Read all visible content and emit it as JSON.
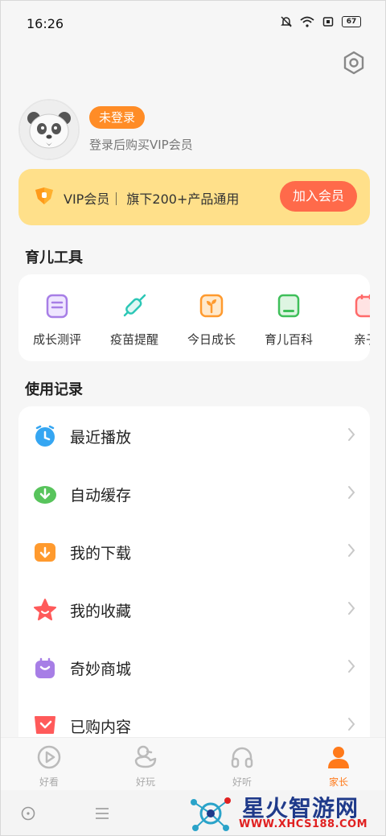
{
  "status_bar": {
    "time": "16:26",
    "battery": "67"
  },
  "profile": {
    "login_badge": "未登录",
    "subtitle": "登录后购买VIP会员"
  },
  "vip_banner": {
    "text": "VIP会员｜ 旗下200+产品通用",
    "button": "加入会员"
  },
  "tools": {
    "title": "育儿工具",
    "items": [
      {
        "label": "成长测评",
        "icon": "clipboard-icon",
        "color": "#a77ee6"
      },
      {
        "label": "疫苗提醒",
        "icon": "syringe-icon",
        "color": "#2cc7b6"
      },
      {
        "label": "今日成长",
        "icon": "sprout-icon",
        "color": "#ff9a2e"
      },
      {
        "label": "育儿百科",
        "icon": "book-icon",
        "color": "#3fbf5a"
      },
      {
        "label": "亲子",
        "icon": "calendar-icon",
        "color": "#ff6a6a"
      }
    ]
  },
  "records": {
    "title": "使用记录",
    "items": [
      {
        "label": "最近播放",
        "icon": "clock-icon",
        "color": "#35a6f2"
      },
      {
        "label": "自动缓存",
        "icon": "cache-download-icon",
        "color": "#58c45c"
      },
      {
        "label": "我的下载",
        "icon": "folder-download-icon",
        "color": "#ff9a2e"
      },
      {
        "label": "我的收藏",
        "icon": "star-icon",
        "color": "#ff5a5a"
      },
      {
        "label": "奇妙商城",
        "icon": "shopping-bag-icon",
        "color": "#a77ee6"
      },
      {
        "label": "已购内容",
        "icon": "cart-icon",
        "color": "#ff5a5a"
      }
    ]
  },
  "tabbar": {
    "items": [
      {
        "label": "好看",
        "icon": "play-circle-icon"
      },
      {
        "label": "好玩",
        "icon": "duck-icon"
      },
      {
        "label": "好听",
        "icon": "headphones-icon"
      },
      {
        "label": "家长",
        "icon": "person-icon"
      }
    ],
    "active_color": "#ff7a1a"
  },
  "watermark": {
    "title": "星火智游网",
    "url": "WWW.XHCS188.COM"
  }
}
